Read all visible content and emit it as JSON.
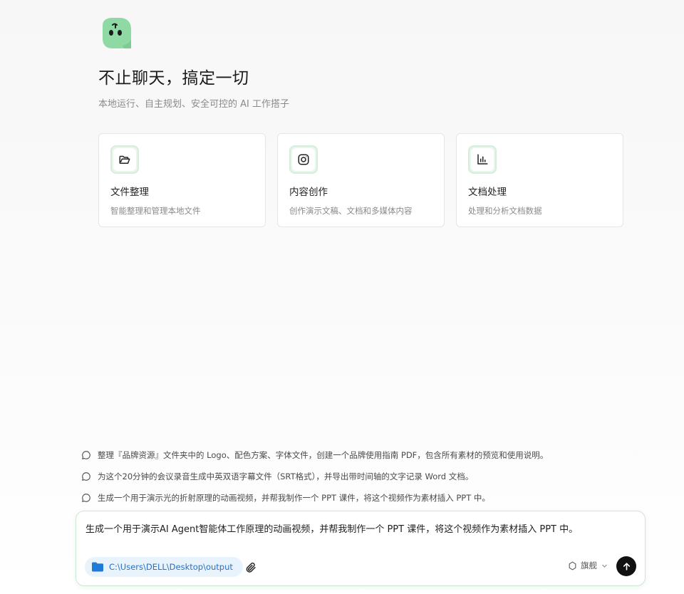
{
  "hero": {
    "logo_icon": "mascot-logo-icon",
    "title": "不止聊天，搞定一切",
    "subtitle": "本地运行、自主规划、安全可控的 AI 工作搭子"
  },
  "cards": [
    {
      "icon": "folder-icon",
      "title": "文件整理",
      "desc": "智能整理和管理本地文件"
    },
    {
      "icon": "instagram-icon",
      "title": "内容创作",
      "desc": "创作演示文稿、文档和多媒体内容"
    },
    {
      "icon": "bar-chart-icon",
      "title": "文档处理",
      "desc": "处理和分析文档数据"
    }
  ],
  "suggestions": [
    "整理『品牌资源』文件夹中的 Logo、配色方案、字体文件，创建一个品牌使用指南 PDF，包含所有素材的预览和使用说明。",
    "为这个20分钟的会议录音生成中英双语字幕文件（SRT格式），并导出带时间轴的文字记录 Word 文档。",
    "生成一个用于演示光的折射原理的动画视频，并帮我制作一个 PPT 课件，将这个视频作为素材插入 PPT 中。"
  ],
  "composer": {
    "value": "生成一个用于演示AI Agent智能体工作原理的动画视频，并帮我制作一个 PPT 课件，将这个视频作为素材插入 PPT 中。",
    "folder_path": "C:\\Users\\DELL\\Desktop\\output",
    "model_label": "旗舰"
  },
  "colors": {
    "accent_green": "#8fd9a5",
    "card_icon_bg": "#e8f6ec",
    "folder_chip_bg": "#e9f3fc",
    "folder_chip_text": "#2b6fc2",
    "send_button": "#111111"
  }
}
